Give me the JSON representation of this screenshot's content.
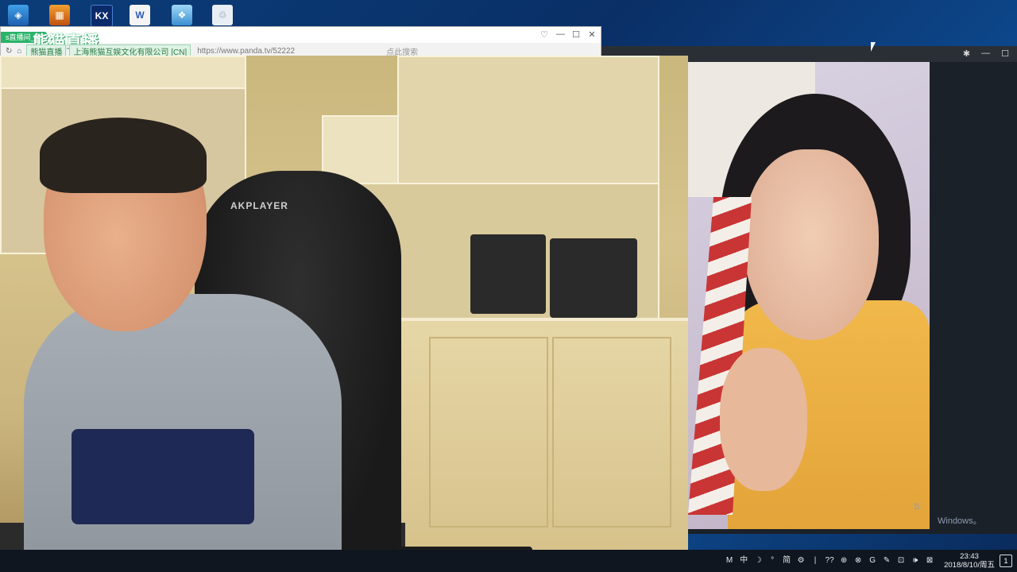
{
  "desktop": {
    "icons": [
      {
        "name": "app-icon-1",
        "glyph": "◈"
      },
      {
        "name": "app-icon-2",
        "glyph": "▦"
      },
      {
        "name": "app-icon-3",
        "glyph": "KX"
      },
      {
        "name": "word-icon",
        "glyph": "W"
      },
      {
        "name": "app-icon-5",
        "glyph": "❖"
      },
      {
        "name": "recycle-bin-icon",
        "glyph": "♲"
      }
    ]
  },
  "browser": {
    "tab_label": "s直播间_英",
    "logo": "熊猫直播",
    "controls": {
      "pin": "♡",
      "minimize": "—",
      "maximize": "☐",
      "close": "✕"
    },
    "address": {
      "back": "↻",
      "home": "⌂",
      "site_badge": "熊猫直播",
      "cert_badge": "上海熊猫互娱文化有限公司 [CN]",
      "url": "https://www.panda.tv/52222",
      "search_placeholder": "点此搜索"
    }
  },
  "dark_window": {
    "controls": {
      "pin": "✱",
      "minimize": "—",
      "maximize": "☐"
    }
  },
  "streamer_video": {
    "chair_brand": "AKPLAYER"
  },
  "watermark": {
    "line1": "S",
    "line2": "Windows。"
  },
  "taskbar": {
    "tray_items": [
      "M",
      "中",
      "☽",
      "°",
      "简",
      "⚙",
      "|",
      "??",
      "⊕",
      "⊗",
      "G",
      "✎",
      "⊡",
      "🕪",
      "⊠"
    ],
    "clock_time": "23:43",
    "clock_date": "2018/8/10/周五",
    "notification": "1"
  },
  "colors": {
    "panda_green": "#2bb36a",
    "taskbar_bg": "#0f1620",
    "desktop_blue": "#0b3d7a"
  }
}
